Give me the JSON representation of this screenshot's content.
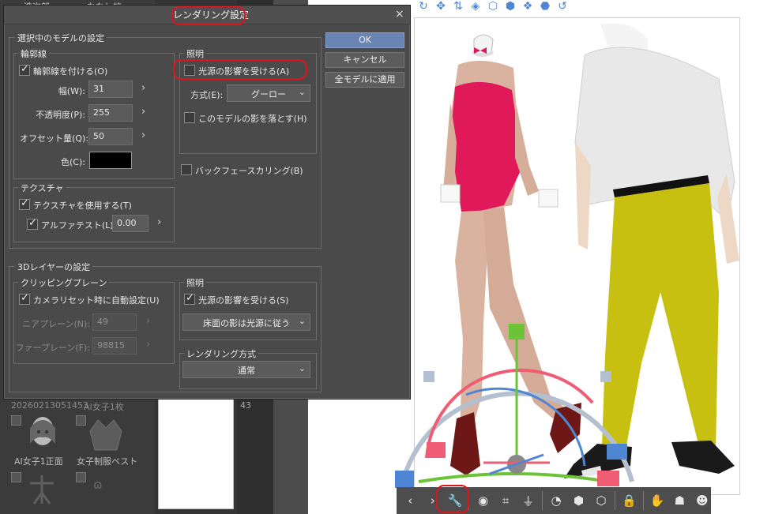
{
  "dialog": {
    "title": "レンダリング設定",
    "close": "×",
    "buttons": {
      "ok": "OK",
      "cancel": "キャンセル",
      "apply_all": "全モデルに適用"
    },
    "selected_model": {
      "section_title": "選択中のモデルの設定",
      "outline": {
        "title": "輪郭線",
        "enable_label": "輪郭線を付ける(O)",
        "width_label": "幅(W):",
        "width_value": "31",
        "opacity_label": "不透明度(P):",
        "opacity_value": "255",
        "offset_label": "オフセット量(Q):",
        "offset_value": "50",
        "color_label": "色(C):",
        "color_value": "#000000"
      },
      "lighting": {
        "title": "照明",
        "light_source_label": "光源の影響を受ける(A)",
        "method_label": "方式(E):",
        "method_value": "グーロー",
        "cast_shadow_label": "このモデルの影を落とす(H)"
      },
      "backface_culling_label": "バックフェースカリング(B)",
      "texture": {
        "title": "テクスチャ",
        "use_texture_label": "テクスチャを使用する(T)",
        "alpha_test_label": "アルファテスト(L)",
        "alpha_test_value": "0.00"
      }
    },
    "layer_3d": {
      "section_title": "3Dレイヤーの設定",
      "clipping": {
        "title": "クリッピングプレーン",
        "auto_label": "カメラリセット時に自動設定(U)",
        "near_label": "ニアプレーン(N):",
        "near_value": "49",
        "far_label": "ファープレーン(F):",
        "far_value": "98815"
      },
      "lighting": {
        "title": "照明",
        "light_source_label": "光源の影響を受ける(S)",
        "floor_shadow_value": "床面の影は光源に従う"
      },
      "rendering": {
        "title": "レンダリング方式",
        "method_value": "通常"
      }
    }
  },
  "background": {
    "left_panel": {
      "top_labels": [
        "進次郎",
        "ななし校"
      ],
      "id_text": "20260213051453",
      "id_text2": "AI女子1枚",
      "item1_label": "AI女子1正面",
      "item2_label": "女子制服ベスト"
    },
    "middle_number": "43"
  },
  "colors": {
    "accent": "#6a84b4",
    "highlight": "#e0131d",
    "pants": "#c8c010",
    "bodysuit": "#e0195a"
  }
}
